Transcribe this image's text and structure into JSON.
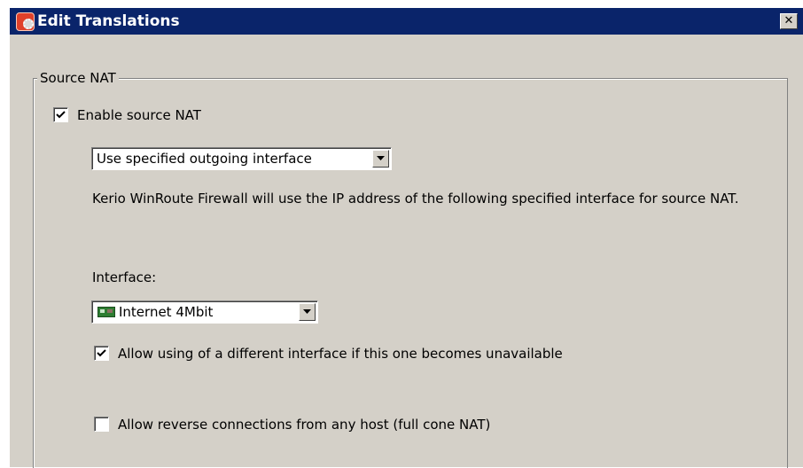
{
  "window": {
    "title": "Edit Translations",
    "close_glyph": "✕",
    "title_icon": "kerio-app-icon"
  },
  "source_nat": {
    "group_label": "Source NAT",
    "enable_checkbox": {
      "label": "Enable source NAT",
      "checked": true
    },
    "mode_select": {
      "value": "Use specified outgoing interface"
    },
    "description": "Kerio WinRoute Firewall will use the IP address of the following specified interface for source NAT.",
    "interface_label": "Interface:",
    "interface_select": {
      "value": "Internet 4Mbit",
      "icon": "network-card-icon"
    },
    "allow_different_checkbox": {
      "label": "Allow using of a different interface if this one becomes unavailable",
      "checked": true
    },
    "full_cone_checkbox": {
      "label": "Allow reverse connections from any host (full cone NAT)",
      "checked": false
    }
  },
  "colors": {
    "titlebar": "#0a246a",
    "face": "#d4d0c8"
  }
}
